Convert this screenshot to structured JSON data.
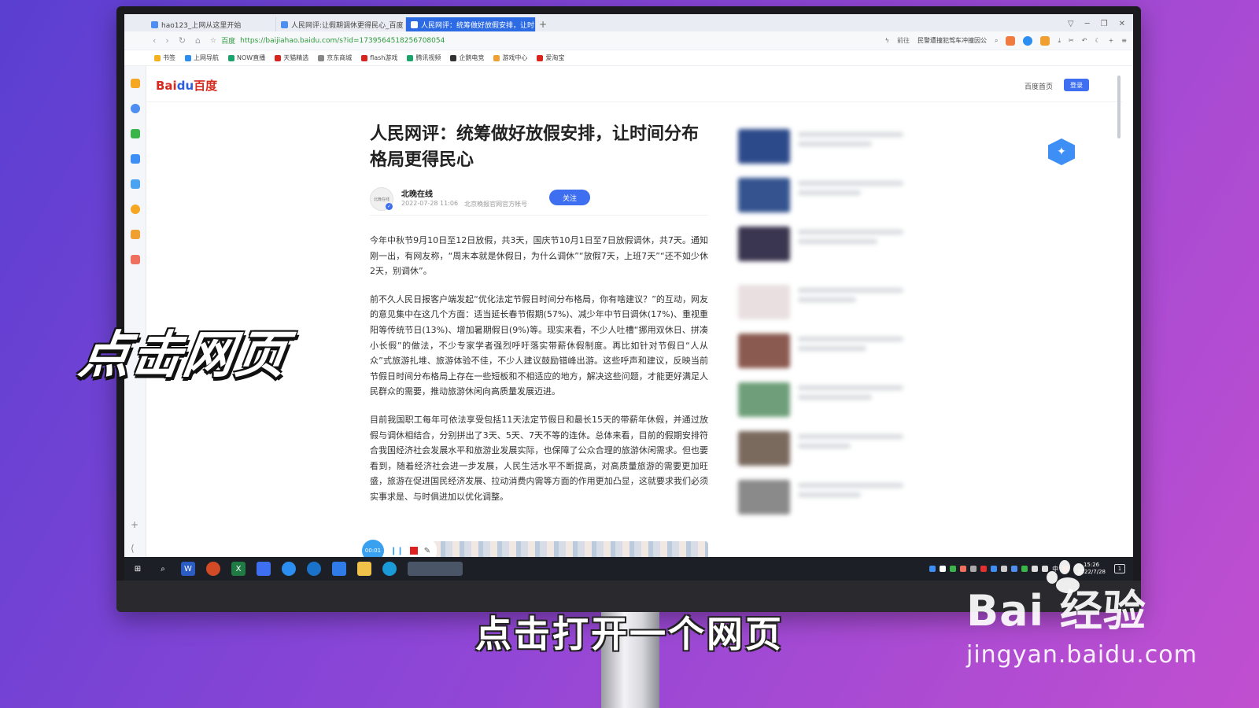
{
  "browser": {
    "tabs": [
      {
        "label": "hao123_上网从这里开始",
        "active": false
      },
      {
        "label": "人民网评:让假期调休更得民心_百度",
        "active": false
      },
      {
        "label": "人民网评：统筹做好放假安排，让时",
        "active": true
      }
    ],
    "new_tab": "+",
    "address": {
      "site_label": "百度",
      "url": "https://baijiahao.baidu.com/s?id=1739564518256708054",
      "forward_label": "前往",
      "search_hint": "民警遭撞犯驾车冲撞因公"
    },
    "bookmarks": [
      "书签",
      "上网导航",
      "NOW直播",
      "天猫精选",
      "京东商城",
      "flash游戏",
      "腾讯视频",
      "企鹅电竞",
      "游戏中心",
      "爱淘宝"
    ]
  },
  "page": {
    "logo": {
      "bai": "Bai",
      "du": "du",
      "baidu": "百度"
    },
    "header_home": "百度首页",
    "header_login": "登录",
    "article": {
      "title": "人民网评：统筹做好放假安排，让时间分布格局更得民心",
      "author": "北晚在线",
      "avatar_text": "北晚在线",
      "date": "2022-07-28 11:06",
      "source": "北京晚报官网官方帐号",
      "follow": "关注",
      "paragraphs": [
        "今年中秋节9月10日至12日放假，共3天，国庆节10月1日至7日放假调休，共7天。通知刚一出，有网友称，“周末本就是休假日，为什么调休”“放假7天，上班7天”“还不如少休2天，别调休”。",
        "前不久人民日报客户端发起“优化法定节假日时间分布格局，你有啥建议？”的互动，网友的意见集中在这几个方面：适当延长春节假期(57%)、减少年中节日调休(17%)、重视重阳等传统节日(13%)、增加暑期假日(9%)等。现实来看，不少人吐槽“挪用双休日、拼凑小长假”的做法，不少专家学者强烈呼吁落实带薪休假制度。再比如针对节假日“人从众”式旅游扎堆、旅游体验不佳，不少人建议鼓励错峰出游。这些呼声和建议，反映当前节假日时间分布格局上存在一些短板和不相适应的地方，解决这些问题，才能更好满足人民群众的需要，推动旅游休闲向高质量发展迈进。",
        "目前我国职工每年可依法享受包括11天法定节假日和最长15天的带薪年休假，并通过放假与调休相结合，分别拼出了3天、5天、7天不等的连休。总体来看，目前的假期安排符合我国经济社会发展水平和旅游业发展实际，也保障了公众合理的旅游休闲需求。但也要看到，随着经济社会进一步发展，人民生活水平不断提高，对高质量旅游的需要更加旺盛，旅游在促进国民经济发展、拉动消费内需等方面的作用更加凸显，这就要求我们必须实事求是、与时俱进加以优化调整。"
      ]
    },
    "recorder_time": "00:01"
  },
  "taskbar": {
    "clock_time": "15:26",
    "clock_date": "2022/7/28",
    "tray_lang": "中"
  },
  "overlay": {
    "left_text": "点击网页",
    "caption": "点击打开一个网页",
    "watermark_main": "Bai  经验",
    "watermark_url": "jingyan.baidu.com"
  }
}
